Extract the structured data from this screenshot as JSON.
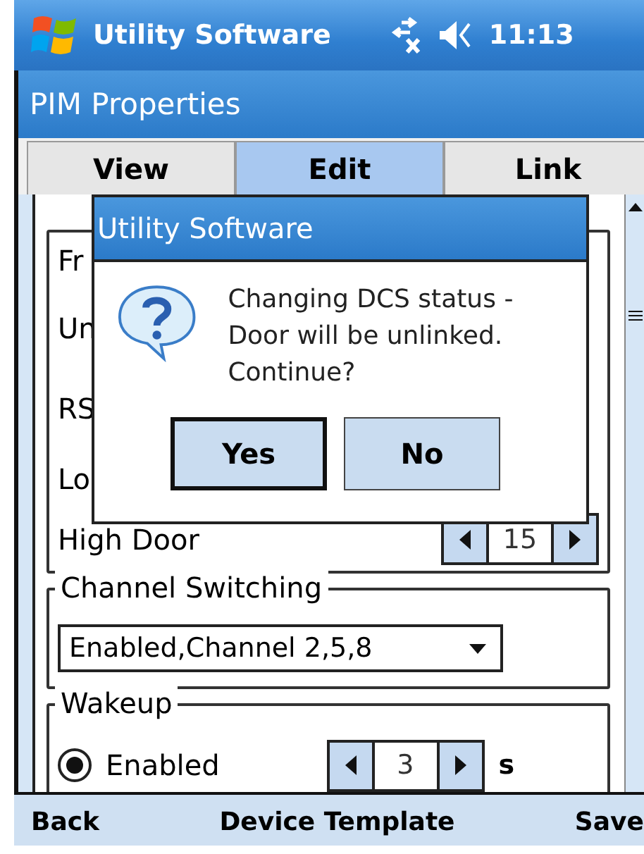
{
  "taskbar": {
    "title": "Utility Software",
    "time": "11:13"
  },
  "window": {
    "title": "PIM Properties"
  },
  "tabs": [
    {
      "label": "View",
      "selected": false
    },
    {
      "label": "Edit",
      "selected": true
    },
    {
      "label": "Link",
      "selected": false
    }
  ],
  "form": {
    "rows": [
      {
        "label": "Fr"
      },
      {
        "label": "Un"
      },
      {
        "label": "RS"
      },
      {
        "label": "Lo"
      },
      {
        "label": "High Door",
        "value": "15"
      }
    ],
    "channel_switching": {
      "legend": "Channel Switching",
      "value": "Enabled,Channel 2,5,8"
    },
    "wakeup": {
      "legend": "Wakeup",
      "option": {
        "label": "Enabled",
        "selected": true
      },
      "value": "3",
      "unit": "s"
    }
  },
  "dialog": {
    "title": "Utility Software",
    "message": "Changing DCS status - Door will be unlinked. Continue?",
    "buttons": [
      {
        "label": "Yes",
        "selected": true
      },
      {
        "label": "No",
        "selected": false
      }
    ]
  },
  "menu_bar": [
    {
      "label": "Back"
    },
    {
      "label": "Device Template"
    },
    {
      "label": "Save"
    }
  ]
}
